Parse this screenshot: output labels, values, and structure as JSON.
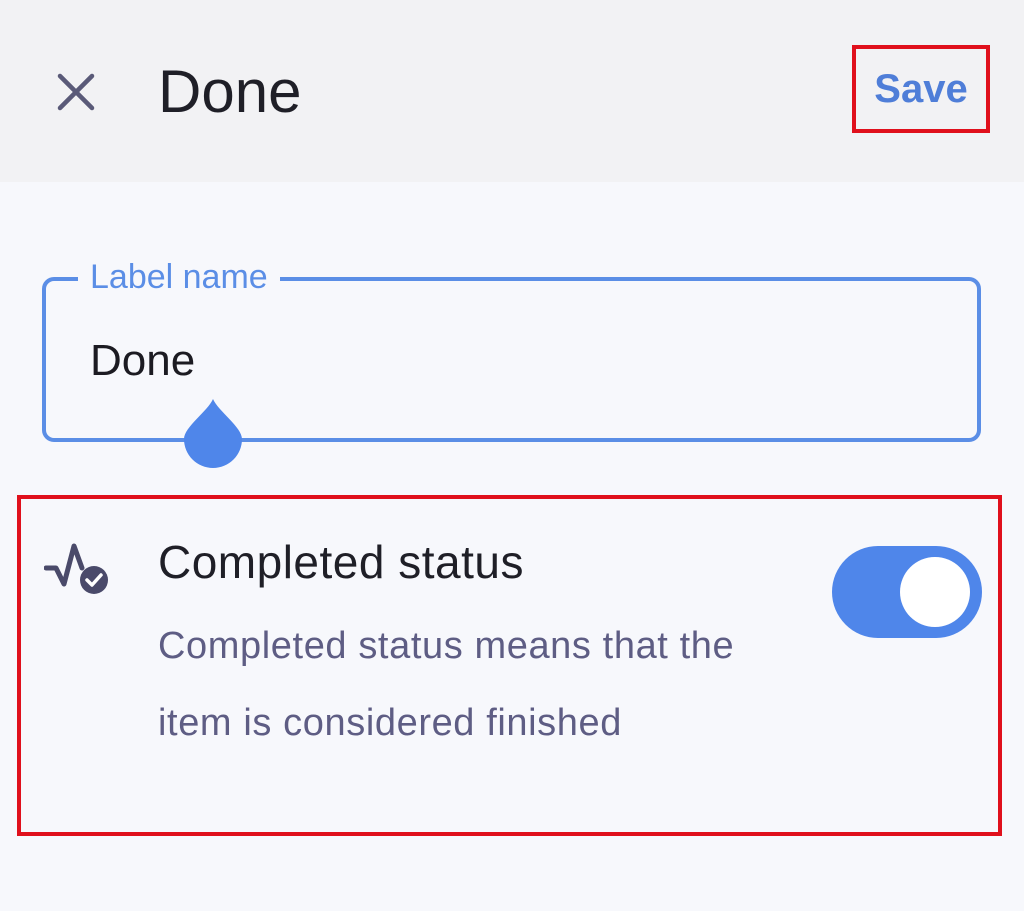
{
  "header": {
    "close_icon": "close-icon",
    "title": "Done",
    "save_label": "Save"
  },
  "label_field": {
    "label": "Label name",
    "value": "Done"
  },
  "completed_status": {
    "icon": "status-check-icon",
    "title": "Completed status",
    "description": "Completed status means that the item is considered finished",
    "enabled": true
  },
  "colors": {
    "accent": "#4f86ea",
    "highlight_box": "#e0101c",
    "description_text": "#5e5d84"
  }
}
